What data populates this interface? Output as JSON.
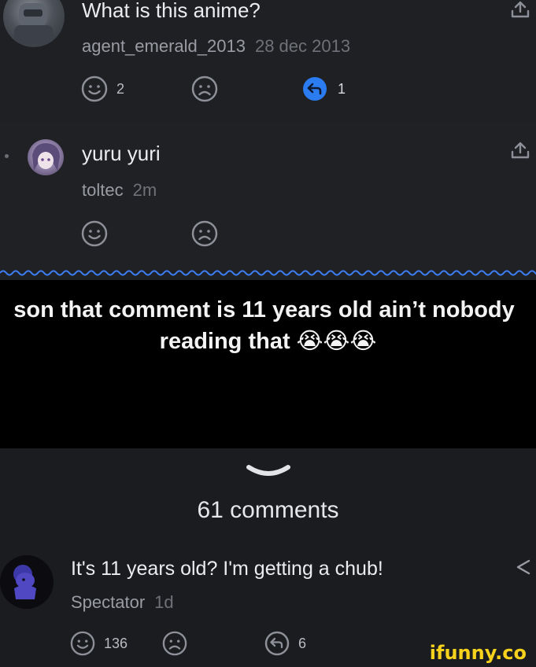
{
  "comment_top": {
    "title": "What is this anime?",
    "username": "agent_emerald_2013",
    "time": "28 dec 2013",
    "smile_count": "2",
    "reply_count": "1"
  },
  "comment_reply": {
    "title": "yuru yuri",
    "username": "toltec",
    "time": "2m"
  },
  "caption": {
    "line1": "son that comment is 11 years old ain’t nobody",
    "line2": "reading that 😭😭😭"
  },
  "comments_header": {
    "count_label": "61 comments"
  },
  "comment_bottom": {
    "title": "It's 11 years old? I'm getting a chub!",
    "username": "Spectator",
    "time": "1d",
    "smile_count": "136",
    "reply_count": "6"
  },
  "watermark": "ifunny.co",
  "colors": {
    "reply_accent": "#2a7cf0",
    "watermark": "#f7d21c"
  }
}
